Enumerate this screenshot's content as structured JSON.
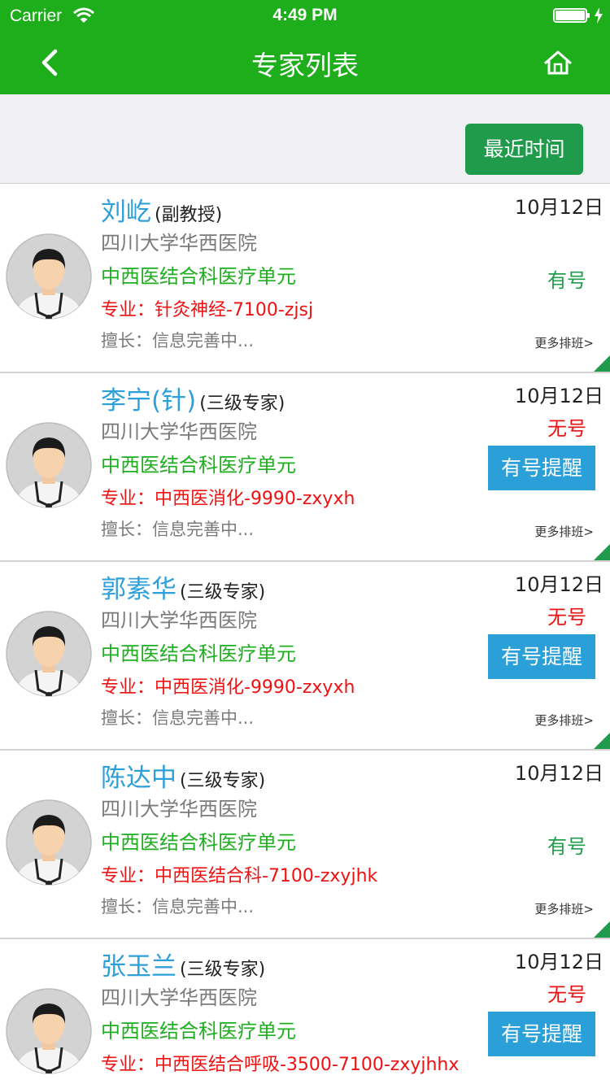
{
  "status_bar": {
    "carrier": "Carrier",
    "time": "4:49 PM"
  },
  "nav": {
    "title": "专家列表",
    "back_icon": "chevron-left-icon",
    "home_icon": "home-icon"
  },
  "filter": {
    "button_label": "最近时间"
  },
  "colors": {
    "brand_green": "#1ead1b",
    "button_green": "#1f9b4b",
    "name_blue": "#2d9fd9",
    "alert_red": "#ee1111",
    "remind_blue": "#2a9fd8"
  },
  "doctors": [
    {
      "name": "刘屹",
      "title": "(副教授)",
      "hospital": "四川大学华西医院",
      "department": "中西医结合科医疗单元",
      "major": "专业：针灸神经-7100-zjsj",
      "specialty": "擅长：信息完善中...",
      "date": "10月12日",
      "availability": "有号",
      "has_slots": true,
      "remind_label": "",
      "more_label": "更多排班>"
    },
    {
      "name": "李宁(针)",
      "title": "(三级专家)",
      "hospital": "四川大学华西医院",
      "department": "中西医结合科医疗单元",
      "major": "专业：中西医消化-9990-zxyxh",
      "specialty": "擅长：信息完善中...",
      "date": "10月12日",
      "availability": "无号",
      "has_slots": false,
      "remind_label": "有号提醒",
      "more_label": "更多排班>"
    },
    {
      "name": "郭素华",
      "title": "(三级专家)",
      "hospital": "四川大学华西医院",
      "department": "中西医结合科医疗单元",
      "major": "专业：中西医消化-9990-zxyxh",
      "specialty": "擅长：信息完善中...",
      "date": "10月12日",
      "availability": "无号",
      "has_slots": false,
      "remind_label": "有号提醒",
      "more_label": "更多排班>"
    },
    {
      "name": "陈达中",
      "title": "(三级专家)",
      "hospital": "四川大学华西医院",
      "department": "中西医结合科医疗单元",
      "major": "专业：中西医结合科-7100-zxyjhk",
      "specialty": "擅长：信息完善中...",
      "date": "10月12日",
      "availability": "有号",
      "has_slots": true,
      "remind_label": "",
      "more_label": "更多排班>"
    },
    {
      "name": "张玉兰",
      "title": "(三级专家)",
      "hospital": "四川大学华西医院",
      "department": "中西医结合科医疗单元",
      "major": "专业：中西医结合呼吸-3500-7100-zxyjhhx",
      "specialty": "",
      "date": "10月12日",
      "availability": "无号",
      "has_slots": false,
      "remind_label": "有号提醒",
      "more_label": ""
    }
  ]
}
